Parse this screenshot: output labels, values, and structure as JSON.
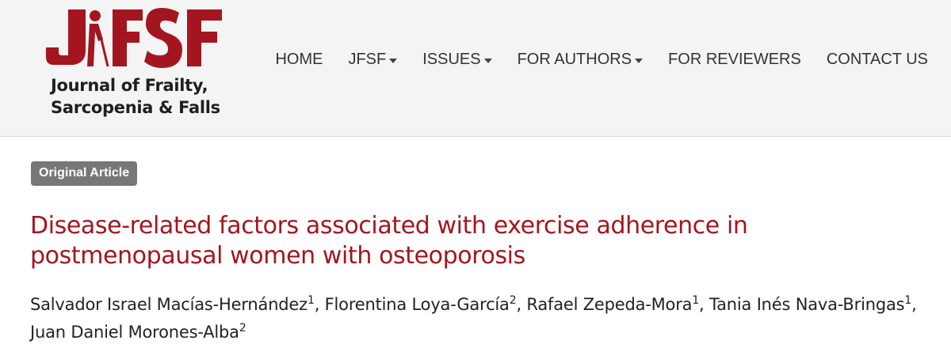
{
  "header": {
    "logo": {
      "mark_text": "JFSF",
      "name_line1": "Journal of Frailty,",
      "name_line2": "Sarcopenia & Falls",
      "brand_color": "#a3161f"
    },
    "nav": [
      {
        "label": "HOME",
        "has_dropdown": false
      },
      {
        "label": "JFSF",
        "has_dropdown": true
      },
      {
        "label": "ISSUES",
        "has_dropdown": true
      },
      {
        "label": "FOR AUTHORS",
        "has_dropdown": true
      },
      {
        "label": "FOR REVIEWERS",
        "has_dropdown": false
      },
      {
        "label": "CONTACT US",
        "has_dropdown": false
      }
    ]
  },
  "article": {
    "type_badge": "Original Article",
    "title": "Disease-related factors associated with exercise adherence in postmenopausal women with osteoporosis",
    "title_color": "#a3161f",
    "authors": [
      {
        "name": "Salvador Israel Macías-Hernández",
        "aff": "1"
      },
      {
        "name": "Florentina Loya-García",
        "aff": "2"
      },
      {
        "name": "Rafael Zepeda-Mora",
        "aff": "1"
      },
      {
        "name": "Tania Inés Nava-Bringas",
        "aff": "1"
      },
      {
        "name": "Juan Daniel Morones-Alba",
        "aff": "2"
      }
    ]
  }
}
